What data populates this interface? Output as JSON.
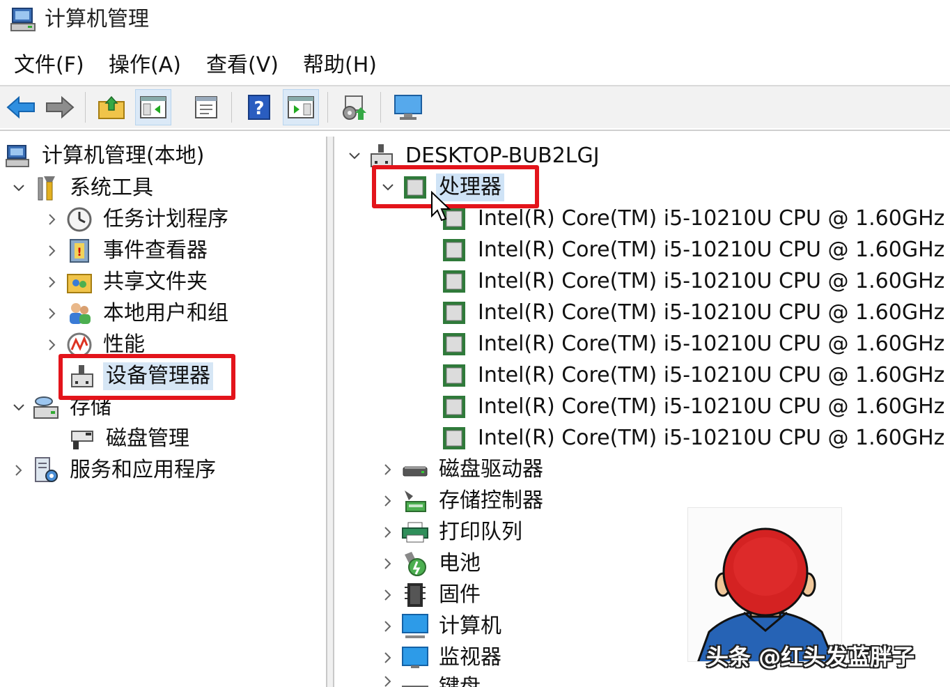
{
  "window": {
    "title": "计算机管理"
  },
  "menu": [
    "文件(F)",
    "操作(A)",
    "查看(V)",
    "帮助(H)"
  ],
  "toolbar": [
    "back-arrow-icon",
    "forward-arrow-icon",
    "up-folder-icon",
    "show-hide-console-tree-icon",
    "properties-icon",
    "help-icon",
    "show-hide-action-pane-icon",
    "scan-hardware-icon",
    "monitor-icon"
  ],
  "left_tree": {
    "root": "计算机管理(本地)",
    "system_tools": "系统工具",
    "task_scheduler": "任务计划程序",
    "event_viewer": "事件查看器",
    "shared_folders": "共享文件夹",
    "local_users": "本地用户和组",
    "performance": "性能",
    "device_manager": "设备管理器",
    "storage": "存储",
    "disk_management": "磁盘管理",
    "services": "服务和应用程序"
  },
  "right_tree": {
    "computer_name": "DESKTOP-BUB2LGJ",
    "processors": "处理器",
    "cpus": [
      "Intel(R) Core(TM) i5-10210U CPU @ 1.60GHz",
      "Intel(R) Core(TM) i5-10210U CPU @ 1.60GHz",
      "Intel(R) Core(TM) i5-10210U CPU @ 1.60GHz",
      "Intel(R) Core(TM) i5-10210U CPU @ 1.60GHz",
      "Intel(R) Core(TM) i5-10210U CPU @ 1.60GHz",
      "Intel(R) Core(TM) i5-10210U CPU @ 1.60GHz",
      "Intel(R) Core(TM) i5-10210U CPU @ 1.60GHz",
      "Intel(R) Core(TM) i5-10210U CPU @ 1.60GHz"
    ],
    "disk_drives": "磁盘驱动器",
    "storage_controllers": "存储控制器",
    "print_queues": "打印队列",
    "batteries": "电池",
    "firmware": "固件",
    "computer": "计算机",
    "monitors": "监视器",
    "keyboards": "键盘"
  },
  "watermark": "头条 @红头发蓝胖子",
  "colors": {
    "highlight_box": "#e3141b",
    "selection": "#d6e6f5"
  }
}
